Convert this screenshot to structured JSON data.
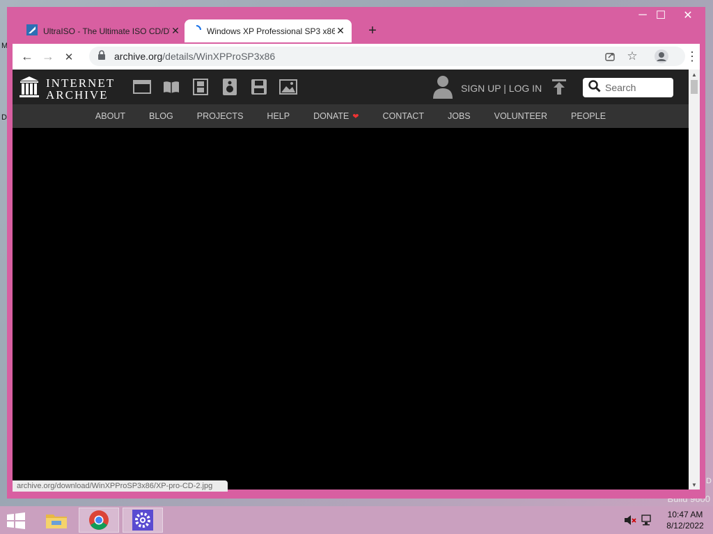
{
  "desktop": {
    "fragment_1": "M",
    "fragment_2": "D",
    "fragment_3": "D",
    "build_text": "Build 9600"
  },
  "tabs": [
    {
      "title": "UltraISO - The Ultimate ISO CD/DVD",
      "close": "✕"
    },
    {
      "title": "Windows XP Professional SP3 x86",
      "close": "✕"
    }
  ],
  "new_tab": "+",
  "window_controls": {
    "minimize": "─",
    "maximize": "☐",
    "close": "✕"
  },
  "nav": {
    "back": "←",
    "forward": "→",
    "stop": "✕"
  },
  "address": {
    "host": "archive.org",
    "path": "/details/WinXPProSP3x86"
  },
  "ia": {
    "logo_line1": "INTERNET",
    "logo_line2": "ARCHIVE",
    "auth": "SIGN UP | LOG IN",
    "search_placeholder": "Search",
    "menu": [
      "ABOUT",
      "BLOG",
      "PROJECTS",
      "HELP",
      "DONATE",
      "CONTACT",
      "JOBS",
      "VOLUNTEER",
      "PEOPLE"
    ]
  },
  "status_url": "archive.org/download/WinXPProSP3x86/XP-pro-CD-2.jpg",
  "clock": {
    "time": "10:47 AM",
    "date": "8/12/2022"
  },
  "icons": [
    "windows-start-icon",
    "file-explorer-icon",
    "chrome-icon",
    "settings-icon",
    "speaker-muted-icon",
    "network-icon"
  ]
}
